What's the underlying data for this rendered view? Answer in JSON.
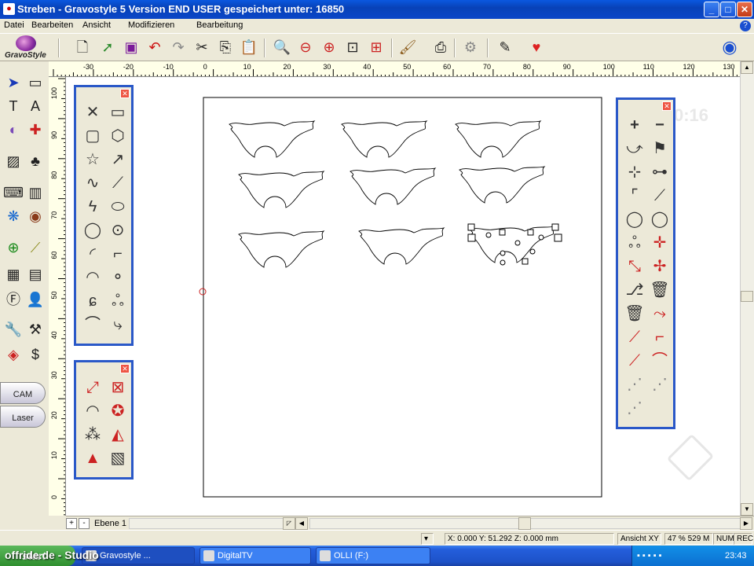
{
  "window": {
    "title": "Streben - Gravostyle 5  Version END USER gespeichert unter: 16850",
    "controls": {
      "minimize": "_",
      "maximize": "□",
      "close": "✕"
    }
  },
  "menu": {
    "items": [
      "Datei",
      "Bearbeiten",
      "Ansicht",
      "Modifizieren",
      "Bearbeitung"
    ],
    "help": "?"
  },
  "logo": {
    "text": "GravoStyle"
  },
  "toolbar": {
    "icons": [
      "new-document-icon",
      "open-icon",
      "save-icon",
      "undo-icon",
      "redo-icon",
      "cut-icon",
      "copy-icon",
      "paste-icon",
      "zoom-icon",
      "zoom-minus-icon",
      "zoom-fit-icon",
      "zoom-page-icon",
      "zoom-select-icon",
      "brush-icon",
      "print-icon",
      "engrave-icon",
      "edit-icon",
      "heart-icon",
      "circle-logo-icon"
    ]
  },
  "ruler": {
    "h_labels": [
      "-30",
      "-20",
      "-10",
      "0",
      "10",
      "20",
      "30",
      "40",
      "50",
      "60",
      "70",
      "80",
      "90",
      "100",
      "110",
      "120",
      "130"
    ],
    "v_labels": [
      "100",
      "90",
      "80",
      "70",
      "60",
      "50",
      "40",
      "30",
      "20",
      "10",
      "0"
    ]
  },
  "left_tools": {
    "cam_label": "CAM",
    "laser_label": "Laser"
  },
  "canvas": {
    "timer": "0:16"
  },
  "layer": {
    "name": "Ebene 1",
    "add": "+",
    "remove": "-"
  },
  "status": {
    "coords": "X: 0.000   Y: 51.292   Z: 0.000 mm",
    "view": "Ansicht XY",
    "zoom": "47 % 529 M",
    "num": "NUM",
    "rec": "REC"
  },
  "taskbar": {
    "start": "start",
    "tasks": [
      "Gravostyle ...",
      "DigitalTV",
      "OLLI (F:)"
    ],
    "clock": "23:43"
  },
  "watermark": {
    "text": "offride.de - Studio"
  }
}
